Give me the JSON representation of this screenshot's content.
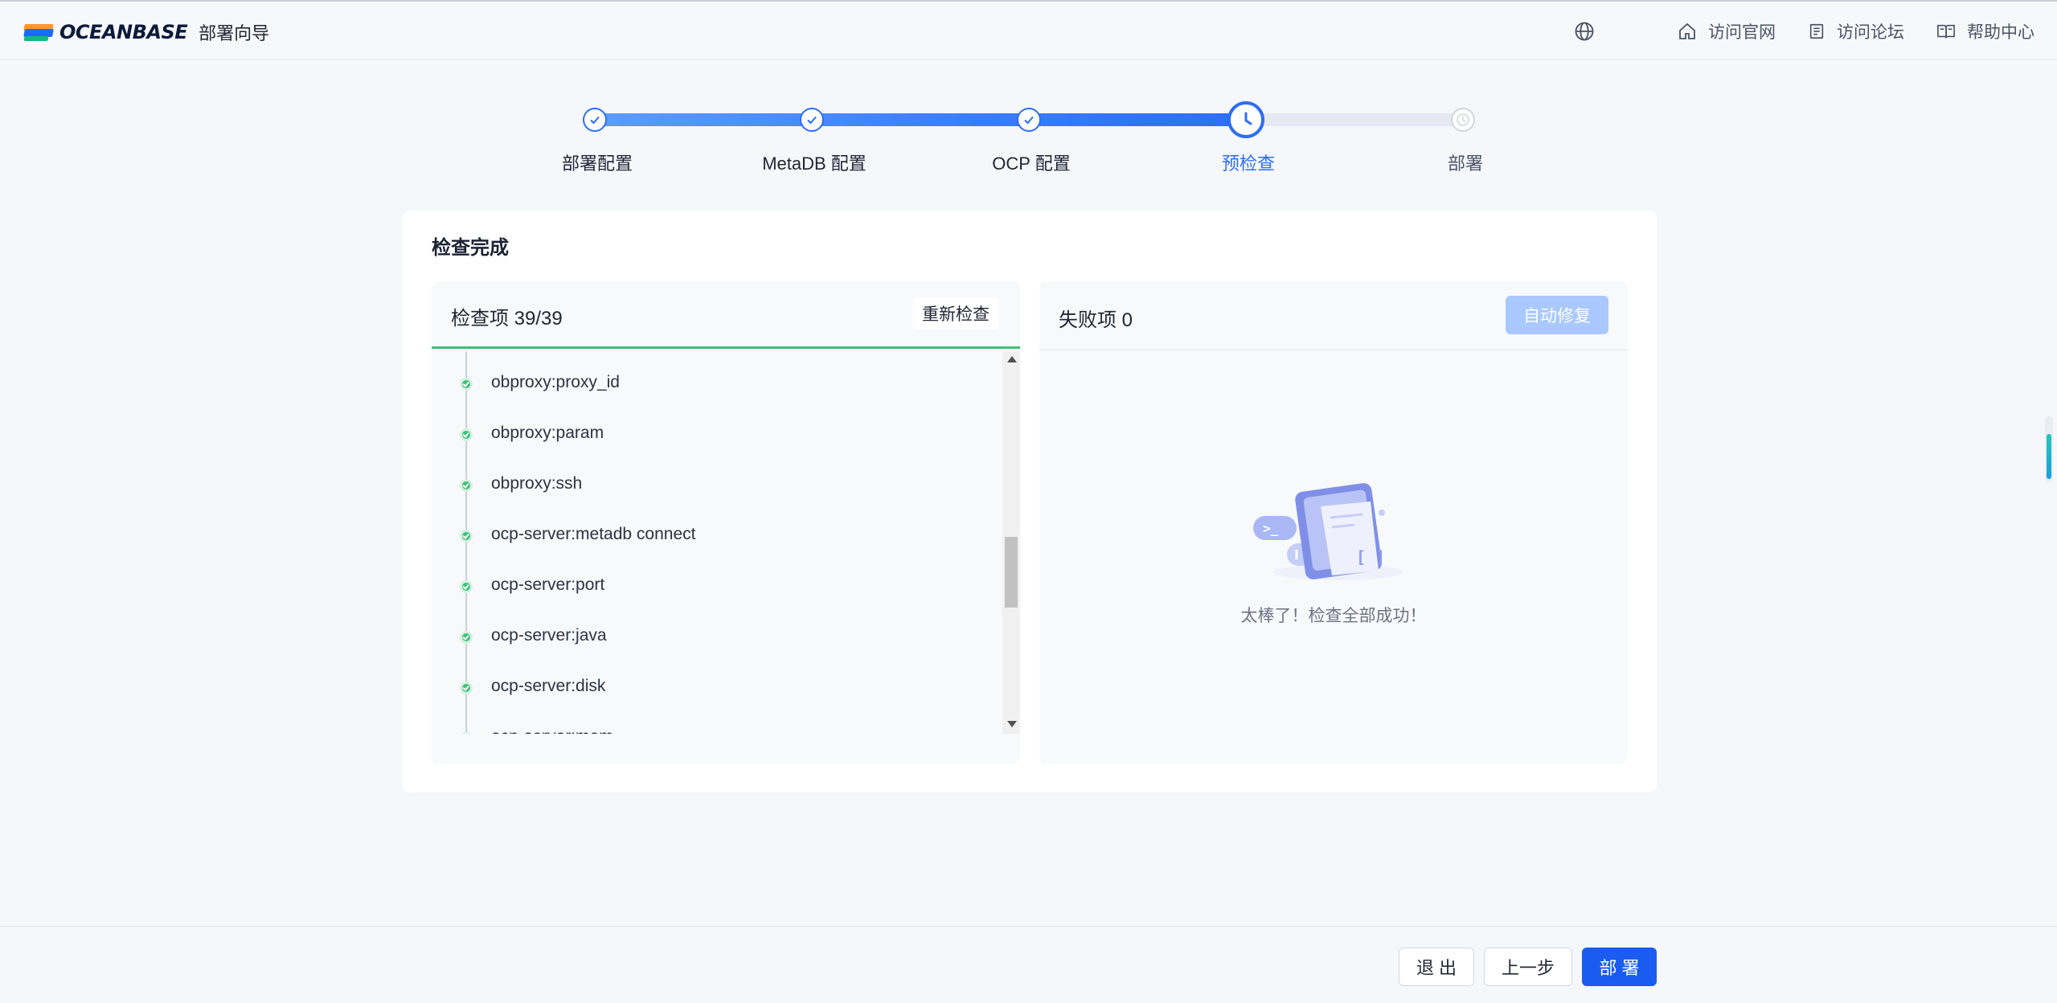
{
  "header": {
    "logo_text": "OCEANBASE",
    "subtitle": "部署向导",
    "nav": [
      {
        "label": "访问官网",
        "icon": "home-icon"
      },
      {
        "label": "访问论坛",
        "icon": "forum-icon"
      },
      {
        "label": "帮助中心",
        "icon": "book-icon"
      }
    ],
    "language_icon": "globe-icon"
  },
  "stepper": {
    "steps": [
      {
        "label": "部署配置",
        "status": "done"
      },
      {
        "label": "MetaDB 配置",
        "status": "done"
      },
      {
        "label": "OCP 配置",
        "status": "done"
      },
      {
        "label": "预检查",
        "status": "active"
      },
      {
        "label": "部署",
        "status": "todo"
      }
    ],
    "progress": 0.75
  },
  "card": {
    "title": "检查完成",
    "checks": {
      "title": "检查项 39/39",
      "recheck_label": "重新检查",
      "items": [
        "obproxy:proxy_id",
        "obproxy:param",
        "obproxy:ssh",
        "ocp-server:metadb connect",
        "ocp-server:port",
        "ocp-server:java",
        "ocp-server:disk",
        "ocp-server:mem"
      ]
    },
    "failures": {
      "title": "失败项 0",
      "autofix_label": "自动修复",
      "empty_text": "太棒了！检查全部成功！"
    }
  },
  "footer": {
    "exit_label": "退 出",
    "prev_label": "上一步",
    "deploy_label": "部 署"
  },
  "colors": {
    "primary": "#2f6df5",
    "success": "#3fbf7a",
    "disabled_primary": "#a9c8ff"
  }
}
